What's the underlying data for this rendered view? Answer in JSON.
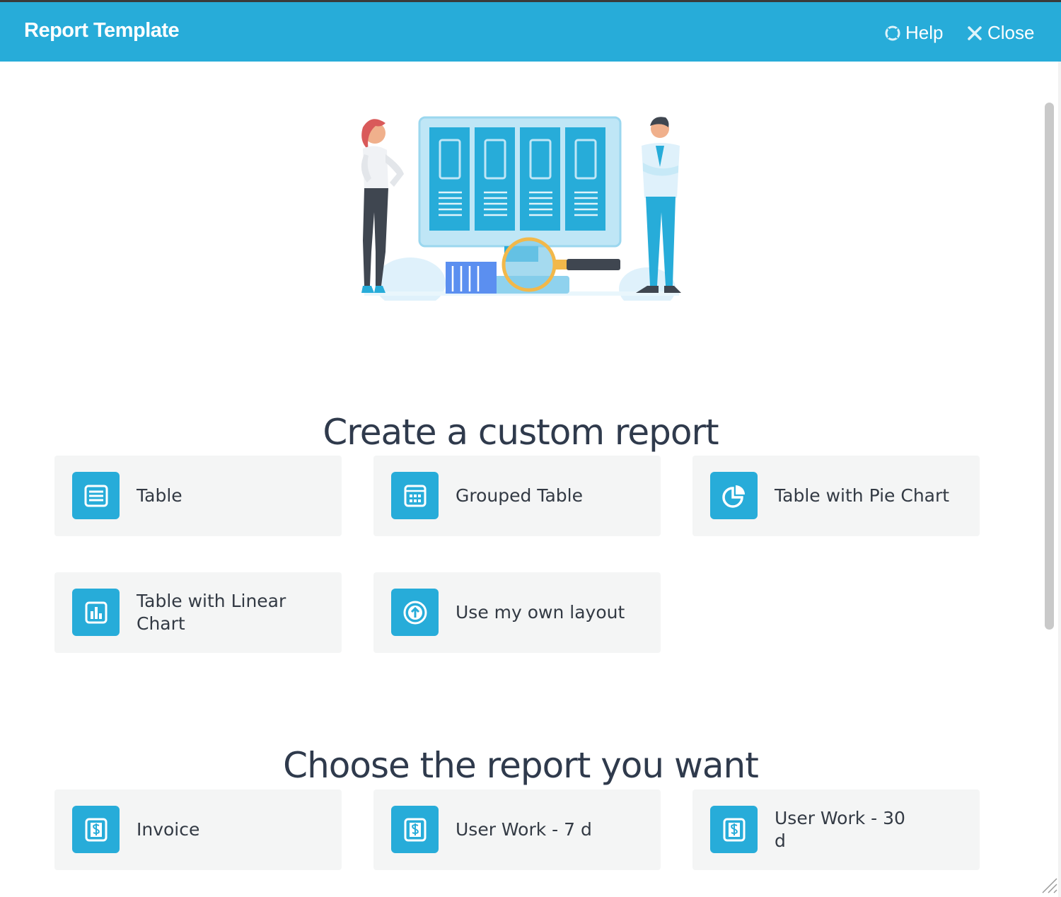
{
  "header": {
    "title": "Report Template",
    "help_label": "Help",
    "close_label": "Close"
  },
  "sections": {
    "custom_title": "Create a custom report",
    "choose_title": "Choose the report you want"
  },
  "custom_cards": [
    {
      "label": "Table",
      "icon": "table-icon"
    },
    {
      "label": "Grouped Table",
      "icon": "grouped-table-icon"
    },
    {
      "label": "Table with Pie Chart",
      "icon": "pie-chart-icon"
    },
    {
      "label": "Table with Linear Chart",
      "icon": "bar-chart-icon"
    },
    {
      "label": "Use my own layout",
      "icon": "upload-icon"
    }
  ],
  "report_cards": [
    {
      "label": "Invoice",
      "icon": "invoice-icon"
    },
    {
      "label": "User Work - 7 d",
      "icon": "invoice-icon"
    },
    {
      "label": "User Work - 30 d",
      "icon": "invoice-icon"
    }
  ],
  "colors": {
    "accent": "#27acd9",
    "card_bg": "#f4f5f5",
    "heading": "#2f3a4c"
  }
}
